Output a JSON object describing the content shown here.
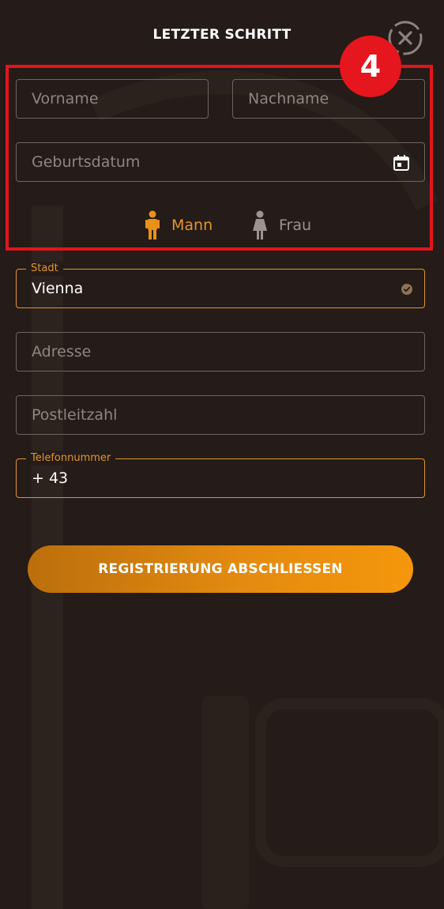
{
  "header": {
    "title": "LETZTER SCHRITT"
  },
  "annotation": {
    "step_number": "4"
  },
  "form": {
    "first_name": {
      "placeholder": "Vorname",
      "value": ""
    },
    "last_name": {
      "placeholder": "Nachname",
      "value": ""
    },
    "birthdate": {
      "placeholder": "Geburtsdatum",
      "value": ""
    },
    "gender": {
      "options": [
        {
          "label": "Mann",
          "selected": true
        },
        {
          "label": "Frau",
          "selected": false
        }
      ]
    },
    "city": {
      "label": "Stadt",
      "value": "Vienna"
    },
    "address": {
      "placeholder": "Adresse",
      "value": ""
    },
    "postal_code": {
      "placeholder": "Postleitzahl",
      "value": ""
    },
    "phone": {
      "label": "Telefonnummer",
      "value": "+ 43"
    },
    "submit_label": "REGISTRIERUNG ABSCHLIESSEN"
  },
  "colors": {
    "background": "#251b18",
    "accent": "#e3962a",
    "annotation": "#e3141b",
    "button_gradient_start": "#bb6f0c",
    "button_gradient_end": "#f5970c"
  },
  "icons": [
    "close-icon",
    "calendar-icon",
    "check-circle-icon",
    "male-icon",
    "female-icon"
  ]
}
